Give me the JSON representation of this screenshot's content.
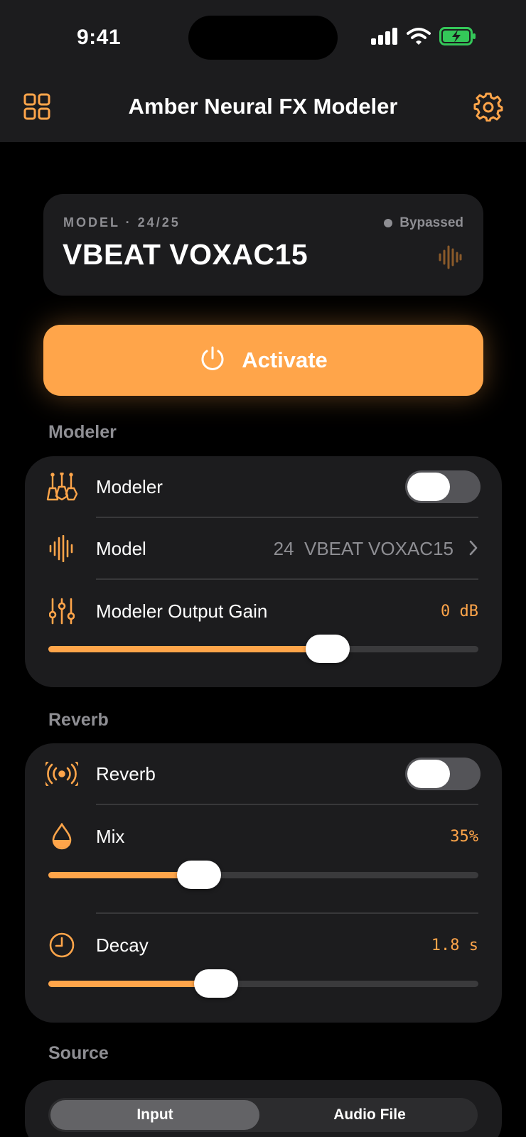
{
  "status_bar": {
    "time": "9:41"
  },
  "nav": {
    "title": "Amber Neural FX Modeler"
  },
  "model_card": {
    "kicker": "MODEL · 24/25",
    "name": "VBEAT VOXAC15",
    "state": "Bypassed"
  },
  "activate": {
    "label": "Activate"
  },
  "sections": {
    "modeler": {
      "heading": "Modeler",
      "toggle_label": "Modeler",
      "toggle_on": false,
      "model_label": "Model",
      "model_value": "24  VBEAT VOXAC15",
      "gain_label": "Modeler Output Gain",
      "gain_value": "0 dB",
      "gain_fraction": 0.65
    },
    "reverb": {
      "heading": "Reverb",
      "toggle_label": "Reverb",
      "toggle_on": false,
      "mix_label": "Mix",
      "mix_value": "35%",
      "mix_fraction": 0.35,
      "decay_label": "Decay",
      "decay_value": "1.8 s",
      "decay_fraction": 0.39
    },
    "source": {
      "heading": "Source",
      "options": [
        "Input",
        "Audio File"
      ],
      "selected": "Input"
    }
  },
  "colors": {
    "accent": "#ffa54a",
    "card": "#1c1c1e",
    "background": "#000000",
    "battery": "#34c759"
  },
  "icons": {
    "nav_left": "grid-icon",
    "nav_right": "gear-icon",
    "modeler": "guitars-icon",
    "model": "waveform-icon",
    "gain": "sliders-icon",
    "reverb": "broadcast-icon",
    "mix": "drop-icon",
    "decay": "clock-icon"
  }
}
